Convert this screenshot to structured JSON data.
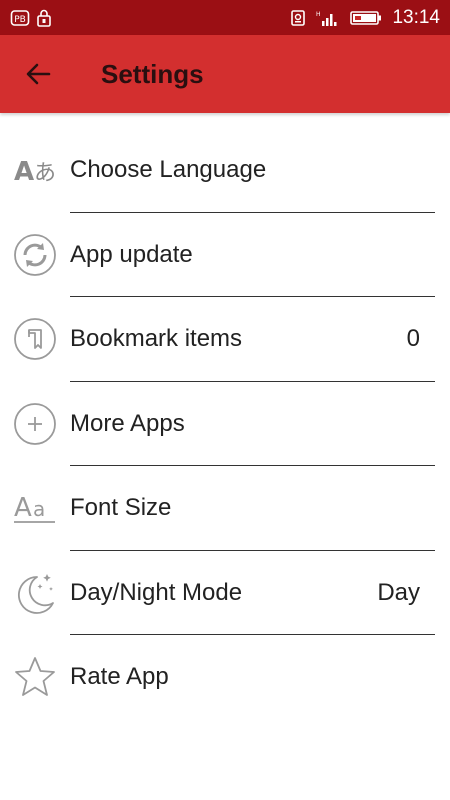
{
  "status_bar": {
    "time": "13:14"
  },
  "header": {
    "title": "Settings",
    "background": "#d32f2f",
    "status_background": "#9b0f14"
  },
  "settings": [
    {
      "icon": "language-icon",
      "label": "Choose Language",
      "value": ""
    },
    {
      "icon": "refresh-icon",
      "label": "App update",
      "value": ""
    },
    {
      "icon": "bookmark-icon",
      "label": "Bookmark items",
      "value": "0"
    },
    {
      "icon": "add-circle-icon",
      "label": "More Apps",
      "value": ""
    },
    {
      "icon": "font-size-icon",
      "label": "Font Size",
      "value": ""
    },
    {
      "icon": "moon-stars-icon",
      "label": "Day/Night Mode",
      "value": "Day"
    },
    {
      "icon": "star-icon",
      "label": "Rate App",
      "value": ""
    }
  ]
}
